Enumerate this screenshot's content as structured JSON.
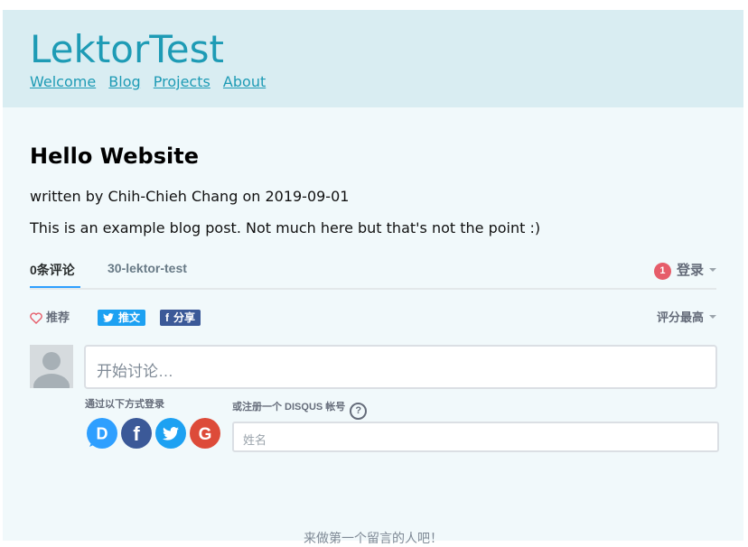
{
  "site": {
    "title": "LektorTest",
    "nav": [
      "Welcome",
      "Blog",
      "Projects",
      "About"
    ]
  },
  "post": {
    "title": "Hello Website",
    "byline": "written by Chih-Chieh Chang on 2019-09-01",
    "body": "This is an example blog post. Not much here but that's not the point :)"
  },
  "disqus": {
    "tabs": [
      "0条评论",
      "30-lektor-test"
    ],
    "login_badge": "1",
    "login_label": "登录",
    "recommend_label": "推荐",
    "tweet_label": "推文",
    "share_label": "分享",
    "sort_label": "评分最高",
    "composer_placeholder": "开始讨论…",
    "login_via_label": "通过以下方式登录",
    "signup_label": "或注册一个 DISQUS 帐号",
    "help_glyph": "?",
    "name_placeholder": "姓名",
    "first_comment": "来做第一个留言的人吧！",
    "social": [
      {
        "name": "disqus",
        "color": "#2e9fff",
        "letter": "D"
      },
      {
        "name": "facebook",
        "color": "#3b5998",
        "letter": "f"
      },
      {
        "name": "twitter",
        "color": "#1da1f2",
        "letter": ""
      },
      {
        "name": "google",
        "color": "#dd4b39",
        "letter": "G"
      }
    ]
  },
  "colors": {
    "accent": "#1e9bb5",
    "header_bg": "#d9edf2",
    "page_bg": "#f1f9fb",
    "heart": "#e65d6a"
  }
}
